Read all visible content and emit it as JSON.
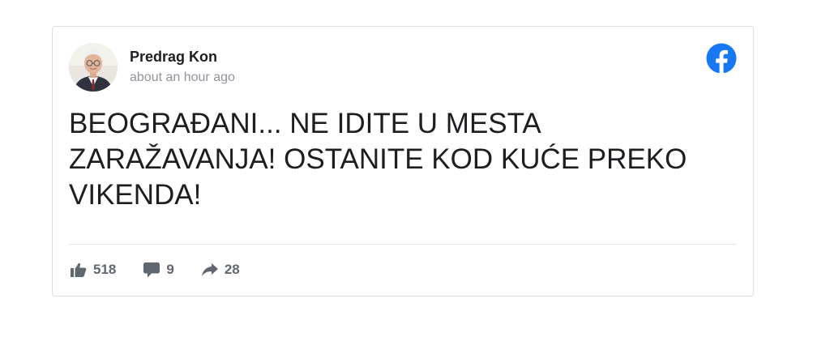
{
  "post": {
    "author": "Predrag Kon",
    "timestamp": "about an hour ago",
    "text": "BEOGRAĐANI... NE IDITE U MESTA ZARAŽAVANJA! OSTANITE KOD KUĆE PREKO VIKENDA!",
    "source_icon": "facebook-logo-icon"
  },
  "stats": {
    "likes": "518",
    "comments": "9",
    "shares": "28"
  },
  "colors": {
    "facebook_blue": "#1877f2",
    "stat_gray": "#606770",
    "timestamp_gray": "#90949c",
    "border": "#dddfe2"
  }
}
